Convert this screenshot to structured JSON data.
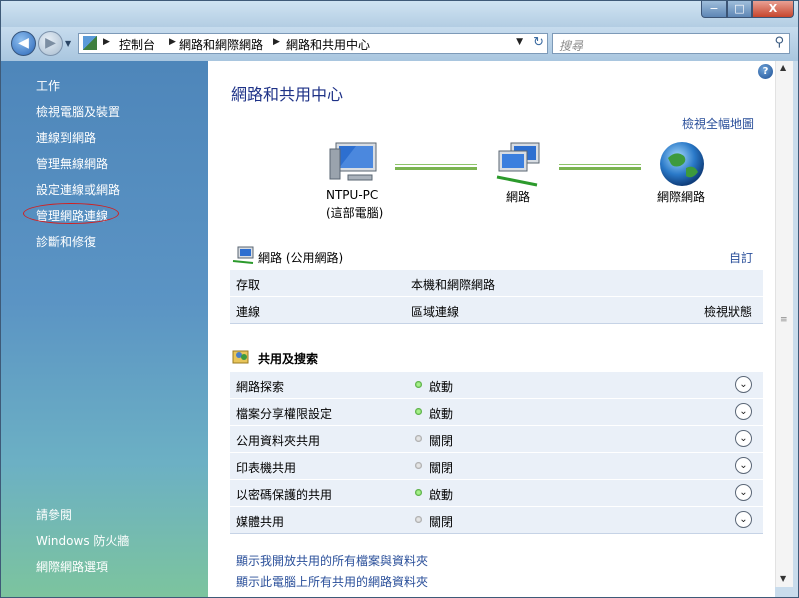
{
  "window": {
    "minimize_label": "−",
    "maximize_label": "□",
    "close_label": "X"
  },
  "nav": {
    "back_label": "◀",
    "forward_label": "▶",
    "breadcrumbs": [
      "控制台",
      "網路和網際網路",
      "網路和共用中心"
    ],
    "search_placeholder": "搜尋"
  },
  "sidebar": {
    "tasks": [
      "工作",
      "檢視電腦及裝置",
      "連線到網路",
      "管理無線網路",
      "設定連線或網路",
      "管理網路連線",
      "診斷和修復"
    ],
    "see_also_title": "請參閱",
    "see_also": [
      "Windows 防火牆",
      "網際網路選項"
    ]
  },
  "main": {
    "title": "網路和共用中心",
    "view_full_map": "檢視全幅地圖",
    "map": {
      "computer_name": "NTPU-PC",
      "computer_sub": "(這部電腦)",
      "network": "網路",
      "internet": "網際網路"
    },
    "network_section": {
      "name": "網路 (公用網路)",
      "customize": "自訂",
      "rows": [
        {
          "label": "存取",
          "value": "本機和網際網路",
          "action": ""
        },
        {
          "label": "連線",
          "value": "區域連線",
          "action": "檢視狀態"
        }
      ]
    },
    "sharing_section": {
      "title": "共用及搜索",
      "rows": [
        {
          "label": "網路探索",
          "status": "啟動",
          "on": true
        },
        {
          "label": "檔案分享權限設定",
          "status": "啟動",
          "on": true
        },
        {
          "label": "公用資料夾共用",
          "status": "關閉",
          "on": false
        },
        {
          "label": "印表機共用",
          "status": "關閉",
          "on": false
        },
        {
          "label": "以密碼保護的共用",
          "status": "啟動",
          "on": true
        },
        {
          "label": "媒體共用",
          "status": "關閉",
          "on": false
        }
      ]
    },
    "bottom_links": [
      "顯示我開放共用的所有檔案與資料夾",
      "顯示此電腦上所有共用的網路資料夾"
    ]
  }
}
